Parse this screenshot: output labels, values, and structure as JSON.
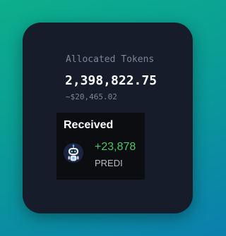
{
  "allocation": {
    "label": "Allocated Tokens",
    "amount": "2,398,822.75",
    "usd_value": "~$20,465.02"
  },
  "received": {
    "title": "Received",
    "amount": "+23,878",
    "token": "PREDI",
    "avatar_icon": "robot-mascot-icon"
  },
  "colors": {
    "card_background": "#171c2b",
    "positive": "#4fc566"
  }
}
